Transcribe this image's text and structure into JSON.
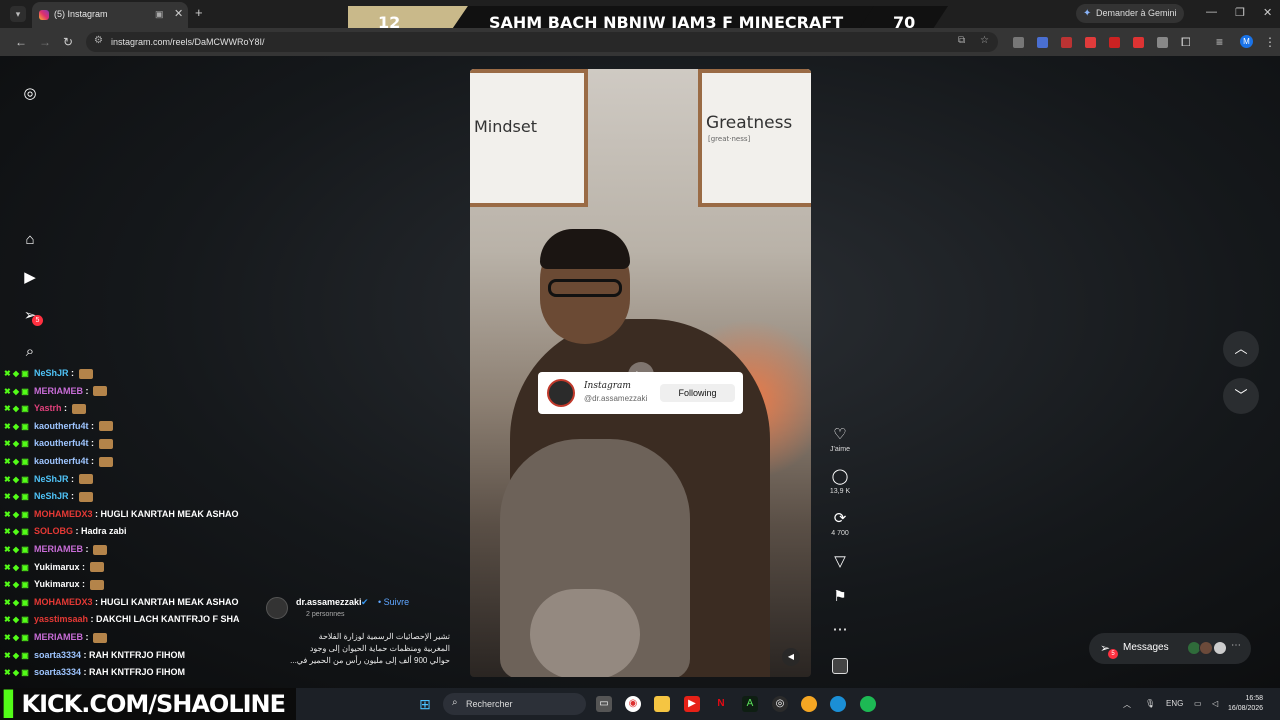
{
  "browser": {
    "tab_title": "(5) Instagram",
    "new_tab": "+",
    "gemini_label": "Demander à Gemini",
    "url": "instagram.com/reels/DaMCWWRoY8I/",
    "profile_initial": "M"
  },
  "stream_banner": {
    "score_left": "12",
    "title": "SAHM BACH NBNIW JAM3 F MINECRAFT",
    "score_right": "70"
  },
  "sidebar": {
    "items": [
      "instagram-logo",
      "home",
      "reels",
      "messages",
      "search"
    ],
    "messages_badge": "5"
  },
  "reel": {
    "frame_left_text": "Mindset",
    "frame_right_text": "Greatness",
    "frame_right_sub": "[great·ness]",
    "follow_card": {
      "name": "Instagram",
      "handle": "@dr.assamezzaki",
      "button": "Following"
    },
    "caption": {
      "username": "dr.assamezzaki",
      "follow": "• Suivre",
      "people": "2 personnes",
      "text_line1": "تشير الإحصائيات الرسمية لوزارة الفلاحة",
      "text_line2": "المغربية ومنظمات حماية الحيوان إلى وجود",
      "text_line3": "حوالي 900 ألف إلى مليون رأس من الحمير في..."
    }
  },
  "actions": {
    "like_label": "J'aime",
    "comments_count": "13,9 K",
    "reposts_count": "4 700"
  },
  "messages_button": {
    "label": "Messages",
    "badge": "5"
  },
  "chat": [
    {
      "user": "NeShJR",
      "color": "#4fc3f7",
      "msg": ""
    },
    {
      "user": "MERIAMEB",
      "color": "#c86dd7",
      "msg": ""
    },
    {
      "user": "Yastrh",
      "color": "#e0407b",
      "msg": ""
    },
    {
      "user": "kaoutherfu4t",
      "color": "#9ec5ff",
      "msg": ""
    },
    {
      "user": "kaoutherfu4t",
      "color": "#9ec5ff",
      "msg": ""
    },
    {
      "user": "kaoutherfu4t",
      "color": "#9ec5ff",
      "msg": ""
    },
    {
      "user": "NeShJR",
      "color": "#4fc3f7",
      "msg": ""
    },
    {
      "user": "NeShJR",
      "color": "#4fc3f7",
      "msg": ""
    },
    {
      "user": "MOHAMEDX3",
      "color": "#e53935",
      "msg": "HUGLI KANRTAH MEAK ASHAO"
    },
    {
      "user": "SOLOBG",
      "color": "#e53935",
      "msg": "Hadra zabi"
    },
    {
      "user": "MERIAMEB",
      "color": "#c86dd7",
      "msg": ""
    },
    {
      "user": "Yukimarux",
      "color": "#ffffff",
      "msg": ""
    },
    {
      "user": "Yukimarux",
      "color": "#ffffff",
      "msg": ""
    },
    {
      "user": "MOHAMEDX3",
      "color": "#e53935",
      "msg": "HUGLI KANRTAH MEAK ASHAO"
    },
    {
      "user": "yasstimsaah",
      "color": "#e53935",
      "msg": "DAKCHI LACH KANTFRJO F SHA"
    },
    {
      "user": "MERIAMEB",
      "color": "#c86dd7",
      "msg": ""
    },
    {
      "user": "soarta3334",
      "color": "#9ec5ff",
      "msg": "RAH KNTFRJO FIHOM"
    },
    {
      "user": "soarta3334",
      "color": "#9ec5ff",
      "msg": "RAH KNTFRJO FIHOM"
    }
  ],
  "kick_banner": "KICK.COM/SHAOLINE",
  "taskbar": {
    "search_placeholder": "Rechercher",
    "language": "ENG",
    "time": "16:58",
    "date": "16/08/2026"
  }
}
